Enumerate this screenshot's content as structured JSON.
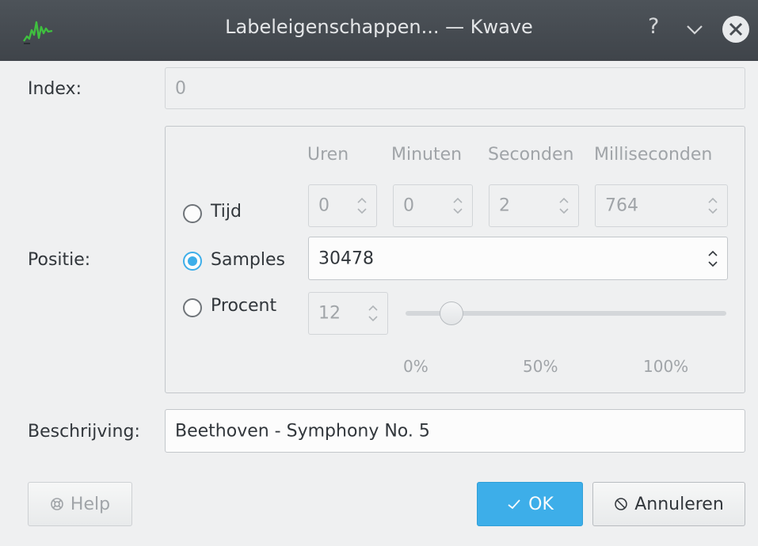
{
  "window": {
    "title": "Labeleigenschappen... — Kwave",
    "help_glyph": "?",
    "icons": {
      "app": "kwave-waveform-icon",
      "minimize": "chevron-down-icon",
      "close": "close-icon"
    }
  },
  "index": {
    "label": "Index:",
    "value": "0"
  },
  "position": {
    "label": "Positie:",
    "columns": [
      "Uren",
      "Minuten",
      "Seconden",
      "Milliseconden"
    ],
    "time": {
      "label": "Tijd",
      "selected": false,
      "hours": "0",
      "minutes": "0",
      "seconds": "2",
      "milliseconds": "764"
    },
    "samples": {
      "label": "Samples",
      "selected": true,
      "value": "30478"
    },
    "percent": {
      "label": "Procent",
      "selected": false,
      "value": "12",
      "slider_fraction": 0.12,
      "ticks": [
        "0%",
        "50%",
        "100%"
      ]
    }
  },
  "description": {
    "label": "Beschrijving:",
    "value": "Beethoven - Symphony No. 5"
  },
  "buttons": {
    "help": "Help",
    "ok": "OK",
    "cancel": "Annuleren"
  },
  "colors": {
    "accent": "#3daee9",
    "titlebar": "#474c52",
    "window_bg": "#eff0f1"
  }
}
